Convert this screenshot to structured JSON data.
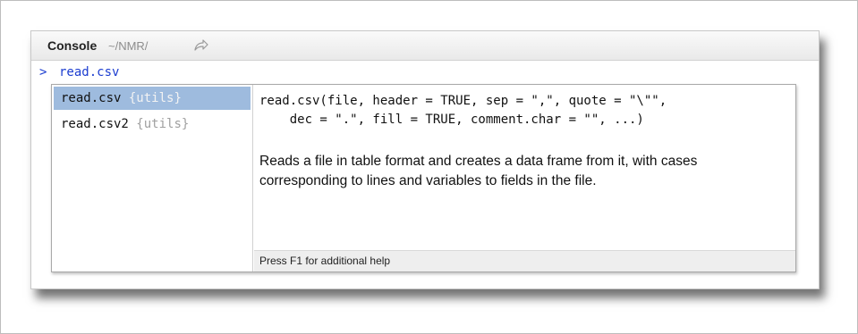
{
  "console": {
    "title": "Console",
    "path": "~/NMR/",
    "goto_icon": "goto-directory-arrow-icon"
  },
  "prompt": {
    "symbol": ">",
    "input_text": "read.csv"
  },
  "completions": [
    {
      "name": "read.csv",
      "package": "{utils}",
      "selected": true
    },
    {
      "name": "read.csv2",
      "package": "{utils}",
      "selected": false
    }
  ],
  "help": {
    "signature_line1": "read.csv(file, header = TRUE, sep = \",\", quote = \"\\\"\",",
    "signature_line2": "    dec = \".\", fill = TRUE, comment.char = \"\", ...)",
    "description": "Reads a file in table format and creates a data frame from it, with cases corresponding to lines and variables to fields in the file.",
    "footer": "Press F1 for additional help"
  },
  "colors": {
    "prompt_blue": "#1c3dd0",
    "selection": "#9ebbde",
    "package_gray": "#a0a0a0"
  }
}
